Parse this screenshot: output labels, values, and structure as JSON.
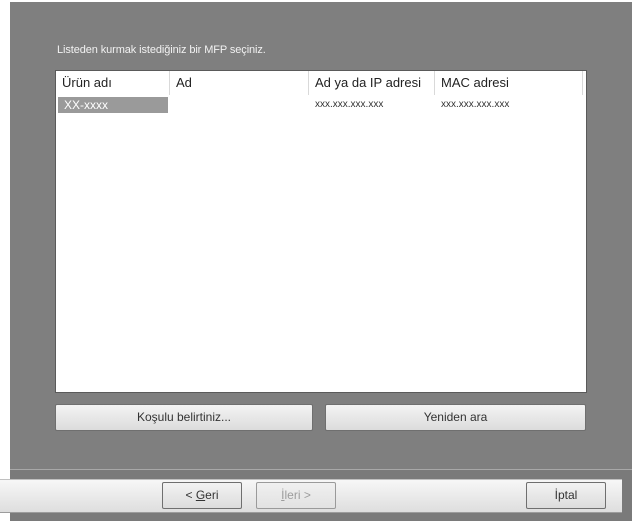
{
  "instruction": "Listeden kurmak istediğiniz bir MFP seçiniz.",
  "table": {
    "columns": [
      "Ürün adı",
      "Ad",
      "Ad ya da IP adresi",
      "MAC adresi"
    ],
    "rows": [
      [
        "XX-xxxx",
        "",
        "xxx.xxx.xxx.xxx",
        "xxx.xxx.xxx.xxx"
      ]
    ]
  },
  "buttons": {
    "specify_condition": "Koşulu belirtiniz...",
    "search_again": "Yeniden ara"
  },
  "nav": {
    "back_arrow": "< ",
    "back_accel": "G",
    "back_rest": "eri",
    "next_accel": "İ",
    "next_rest": "leri",
    "next_arrow": " >",
    "cancel": "İptal"
  },
  "colors": {
    "dialog_bg": "#7f7f7f",
    "selection": "#9a9a9a"
  }
}
